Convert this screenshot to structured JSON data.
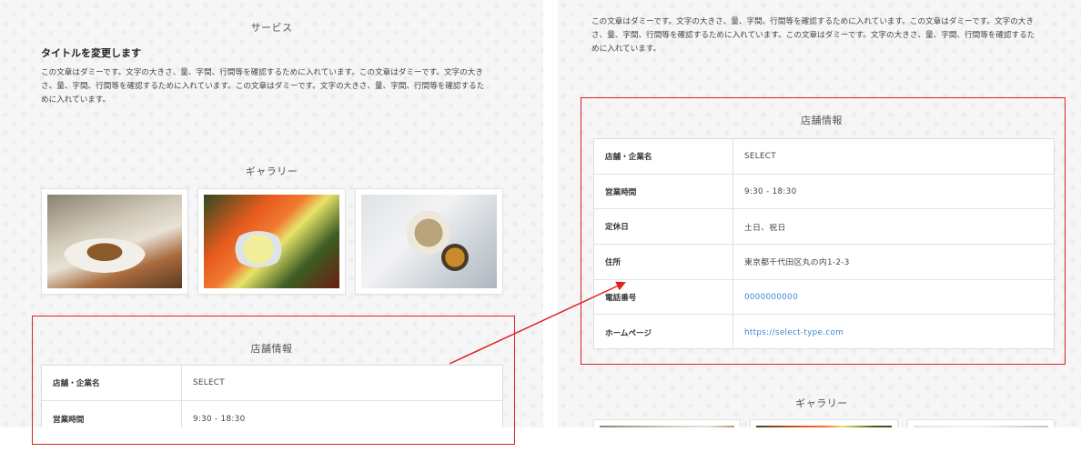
{
  "left": {
    "service_heading": "サービス",
    "title": "タイトルを変更します",
    "body_lines": [
      "この文章はダミーです。文字の大きさ、量、字間、行間等を確認するために入れています。この文章はダミーです。文字の大き",
      "さ、量、字間、行間等を確認するために入れています。この文章はダミーです。文字の大きさ、量、字間、行間等を確認するた",
      "めに入れています。"
    ],
    "gallery_heading": "ギャラリー",
    "gallery_images": [
      "cake-photo",
      "salad-photo",
      "japanese-meal-photo"
    ],
    "shop_heading": "店舗情報",
    "shop_rows": [
      {
        "label": "店舗・企業名",
        "value": "SELECT"
      },
      {
        "label": "営業時間",
        "value": "9:30 - 18:30"
      }
    ]
  },
  "right": {
    "body_lines": [
      "この文章はダミーです。文字の大きさ、量、字間、行間等を確認するために入れています。この文章はダミーです。文字の大き",
      "さ、量、字間、行間等を確認するために入れています。この文章はダミーです。文字の大きさ、量、字間、行間等を確認するた",
      "めに入れています。"
    ],
    "shop_heading": "店舗情報",
    "shop_rows": [
      {
        "label": "店舗・企業名",
        "value": "SELECT"
      },
      {
        "label": "営業時間",
        "value": "9:30 - 18:30"
      },
      {
        "label": "定休日",
        "value": "土日、祝日"
      },
      {
        "label": "住所",
        "value": "東京都千代田区丸の内1-2-3"
      },
      {
        "label": "電話番号",
        "value": "0000000000"
      },
      {
        "label": "ホームページ",
        "value": "https://select-type.com"
      }
    ],
    "gallery_heading": "ギャラリー"
  },
  "colors": {
    "annotation_red": "#e02020",
    "link_blue": "#3b86d6",
    "panel_bg": "#f6f6f6"
  }
}
